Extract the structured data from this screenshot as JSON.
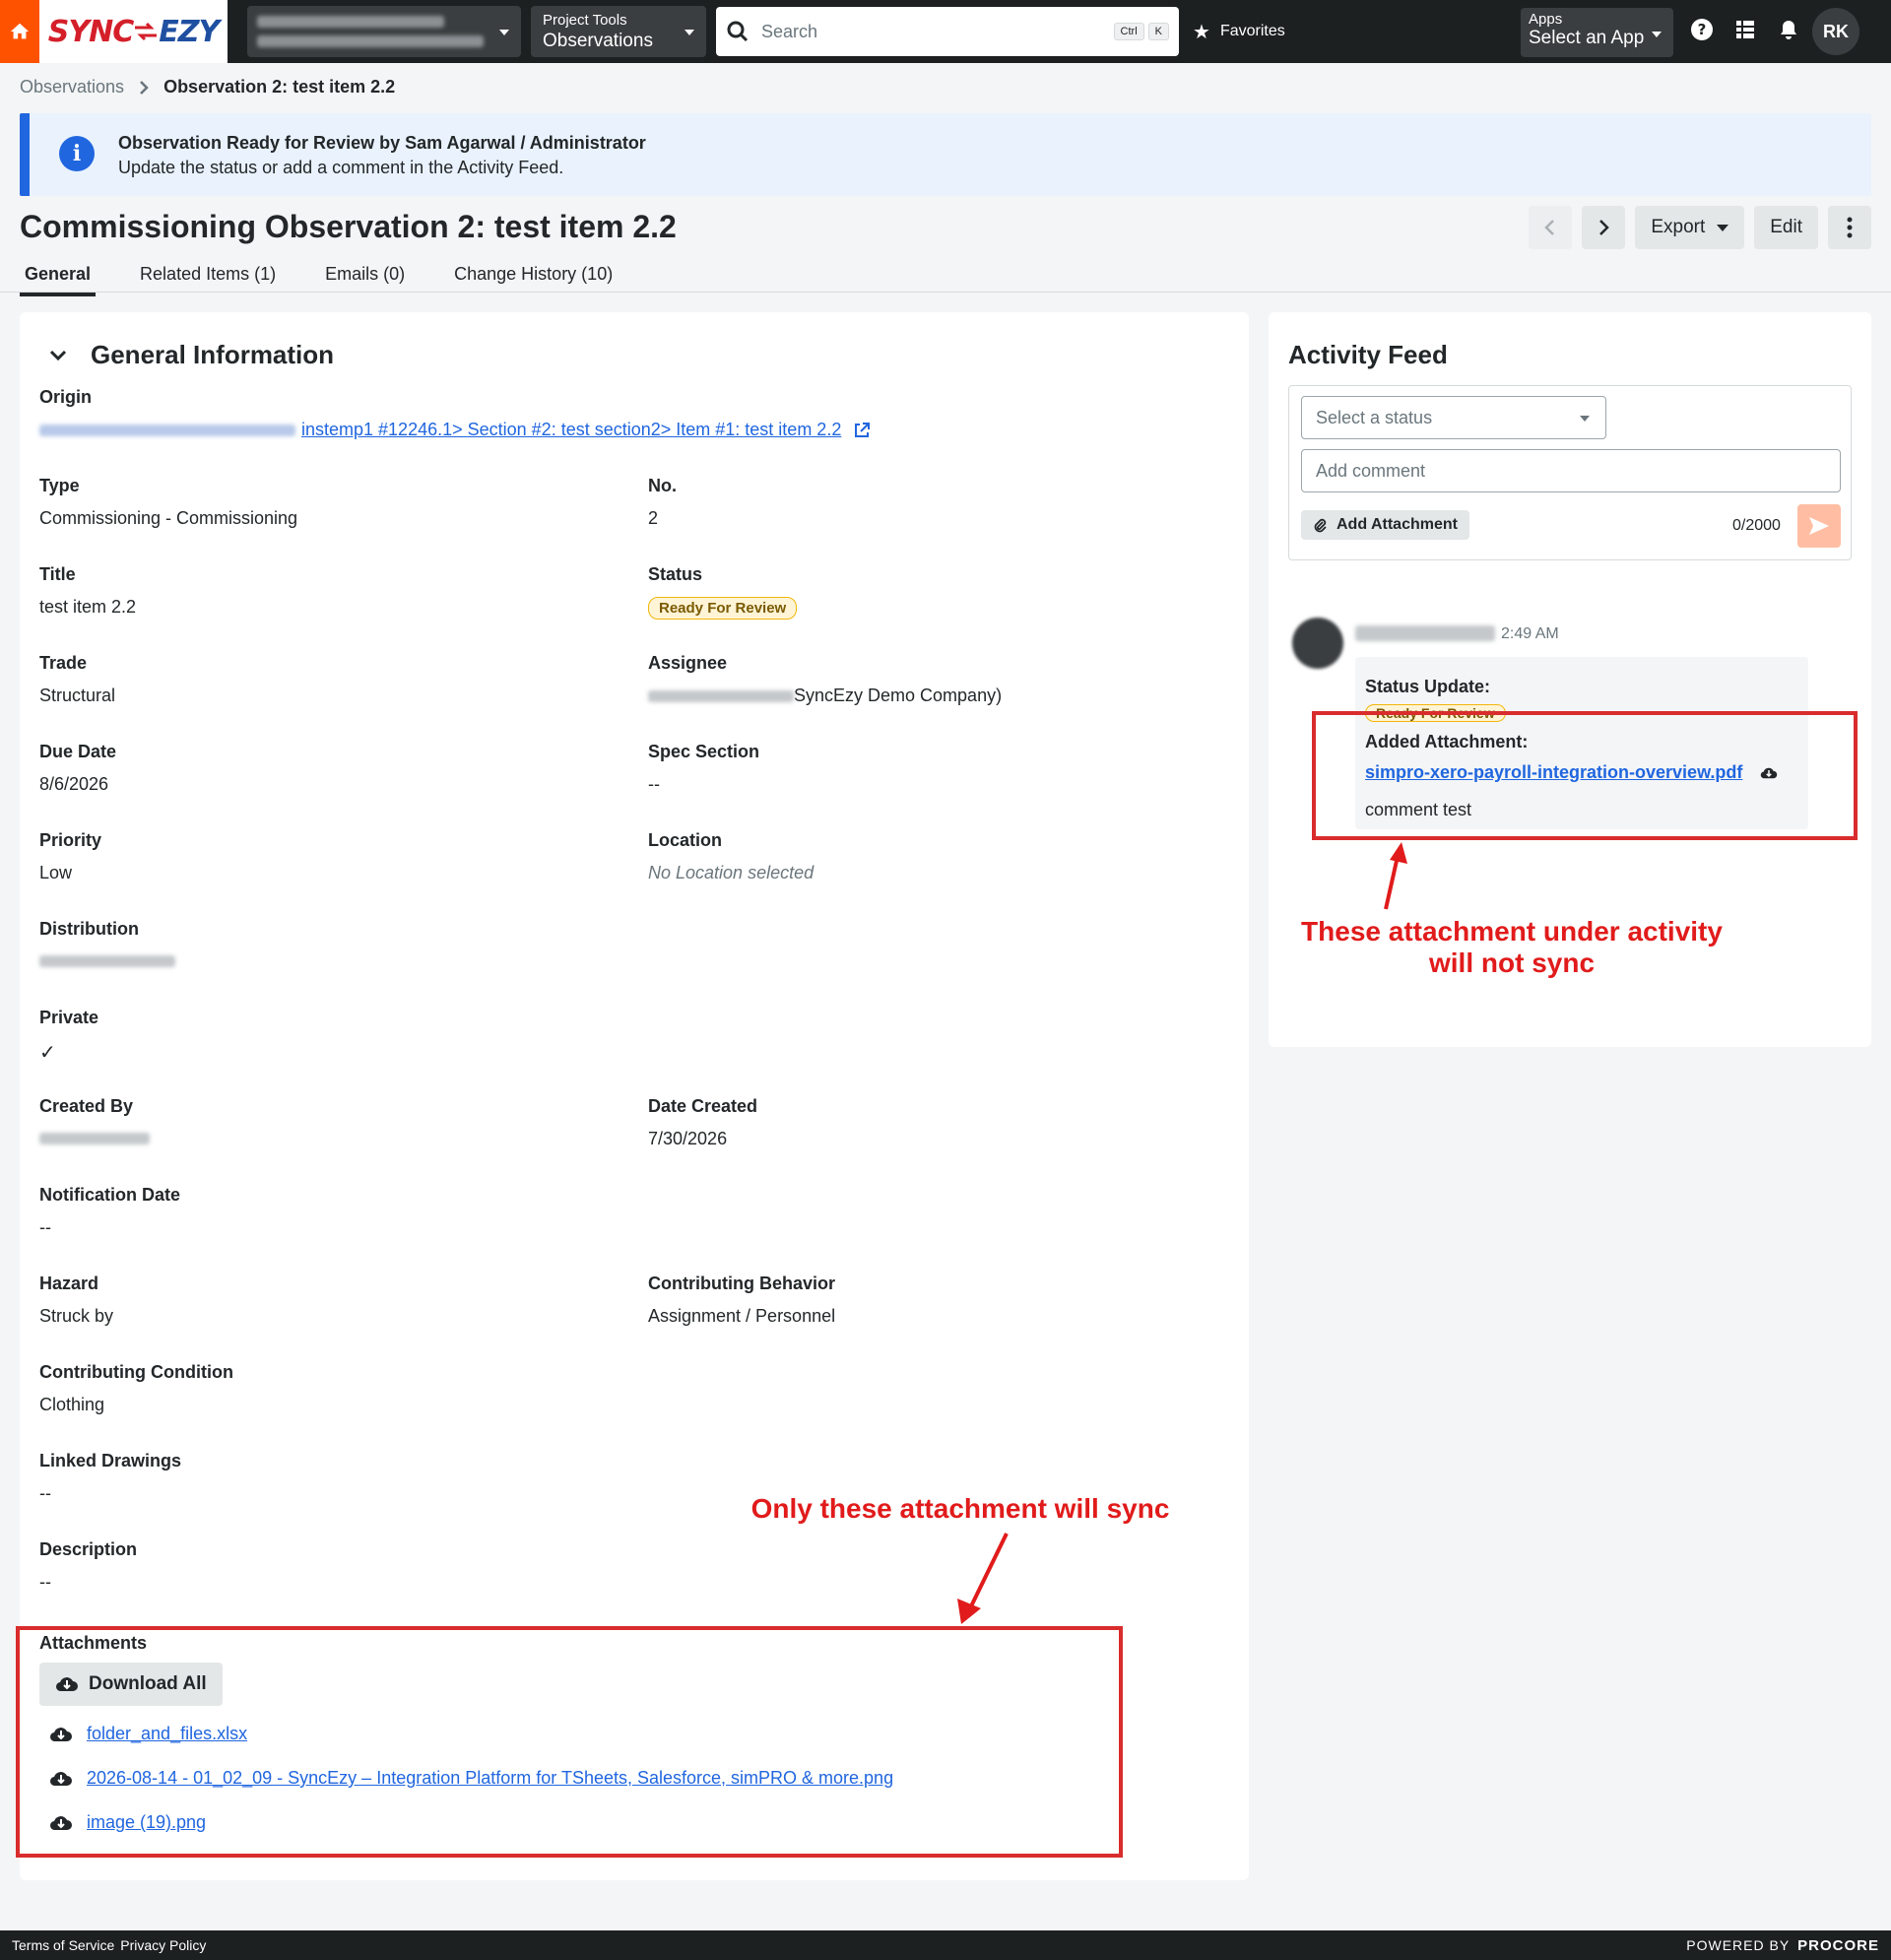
{
  "topbar": {
    "logo_part1": "SYNC",
    "logo_part2": "EZY",
    "tool_small": "Project Tools",
    "tool_big": "Observations",
    "search_placeholder": "Search",
    "kbd1": "Ctrl",
    "kbd2": "K",
    "favorites": "Favorites",
    "apps_small": "Apps",
    "apps_big": "Select an App",
    "user_initials": "RK"
  },
  "breadcrumb": {
    "parent": "Observations",
    "current": "Observation 2: test item 2.2"
  },
  "banner": {
    "title": "Observation Ready for Review by Sam Agarwal / Administrator",
    "message": "Update the status or add a comment in the Activity Feed."
  },
  "header": {
    "title": "Commissioning Observation 2: test item 2.2",
    "export_label": "Export",
    "edit_label": "Edit"
  },
  "tabs": [
    {
      "label": "General"
    },
    {
      "label": "Related Items (1)"
    },
    {
      "label": "Emails (0)"
    },
    {
      "label": "Change History (10)"
    }
  ],
  "general": {
    "section_title": "General Information",
    "origin_label": "Origin",
    "origin_link": " instemp1 #12246.1> Section #2: test section2> Item #1: test item 2.2",
    "type_label": "Type",
    "type_value": "Commissioning - Commissioning",
    "no_label": "No.",
    "no_value": "2",
    "title_label": "Title",
    "title_value": "test item 2.2",
    "status_label": "Status",
    "status_value": "Ready For Review",
    "trade_label": "Trade",
    "trade_value": "Structural",
    "assignee_label": "Assignee",
    "assignee_suffix": "SyncEzy Demo Company)",
    "due_label": "Due Date",
    "due_value": "8/6/2026",
    "spec_label": "Spec Section",
    "spec_value": "--",
    "priority_label": "Priority",
    "priority_value": "Low",
    "location_label": "Location",
    "location_value": "No Location selected",
    "distribution_label": "Distribution",
    "private_label": "Private",
    "private_value": "✓",
    "created_by_label": "Created By",
    "date_created_label": "Date Created",
    "date_created_value": "7/30/2026",
    "notification_label": "Notification Date",
    "notification_value": "--",
    "hazard_label": "Hazard",
    "hazard_value": "Struck by",
    "behavior_label": "Contributing Behavior",
    "behavior_value": "Assignment / Personnel",
    "condition_label": "Contributing Condition",
    "condition_value": "Clothing",
    "drawings_label": "Linked Drawings",
    "drawings_value": "--",
    "description_label": "Description",
    "description_value": "--",
    "attachments_label": "Attachments",
    "download_all": "Download All",
    "attachments": [
      "folder_and_files.xlsx",
      "2026-08-14 - 01_02_09 - SyncEzy – Integration Platform for TSheets, Salesforce, simPRO & more.png",
      "image (19).png"
    ]
  },
  "activity": {
    "title": "Activity Feed",
    "status_placeholder": "Select a status",
    "comment_placeholder": "Add comment",
    "add_attachment": "Add Attachment",
    "counter": "0/2000",
    "time": "2:49 AM",
    "status_update_label": "Status Update:",
    "status_badge": "Ready For Review",
    "added_attachment_label": "Added Attachment:",
    "attachment_link": "simpro-xero-payroll-integration-overview.pdf",
    "comment": "comment test"
  },
  "annotations": {
    "not_sync_line1": "These attachment under activity",
    "not_sync_line2": "will not sync",
    "will_sync": "Only these attachment will sync"
  },
  "footer": {
    "terms": "Terms of Service",
    "privacy": "Privacy Policy",
    "powered": "POWERED BY",
    "brand": "PROCORE"
  },
  "colors": {
    "accent": "#ff5200",
    "link": "#2066df",
    "annotation_red": "#e11b1b",
    "badge_yellow": "#f2b70a"
  }
}
